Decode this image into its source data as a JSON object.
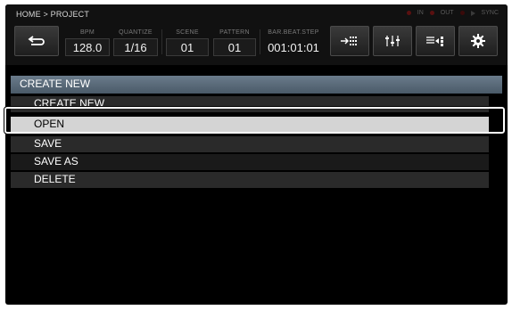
{
  "breadcrumb": "HOME > PROJECT",
  "status": {
    "in": "IN",
    "out": "OUT",
    "sync": "SYNC"
  },
  "toolbar": {
    "back_icon": "return-arrow-icon",
    "params": [
      {
        "label": "BPM",
        "value": "128.0"
      },
      {
        "label": "QUANTIZE",
        "value": "1/16"
      },
      {
        "label": "SCENE",
        "value": "01"
      },
      {
        "label": "PATTERN",
        "value": "01"
      },
      {
        "label": "BAR.BEAT.STEP",
        "value": "001:01:01"
      }
    ],
    "icons": [
      "step-input-icon",
      "mixer-faders-icon",
      "sequence-icon",
      "settings-gear-icon"
    ]
  },
  "menu": {
    "header": "CREATE NEW",
    "items": [
      "CREATE NEW",
      "OPEN",
      "SAVE",
      "SAVE AS",
      "DELETE"
    ],
    "selected": "OPEN"
  },
  "colors": {
    "header_bar": "#5a6b7a",
    "selected_row": "#d4d4d4",
    "background": "#000000"
  }
}
